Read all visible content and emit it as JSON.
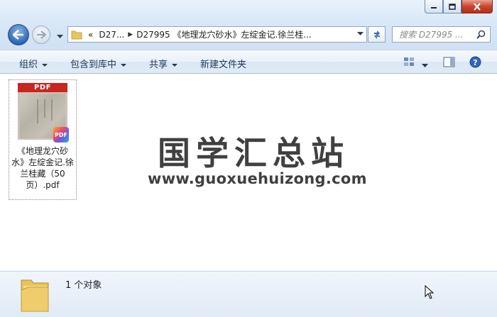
{
  "window": {
    "caption_buttons": [
      "minimize",
      "maximize",
      "close"
    ]
  },
  "address_bar": {
    "overflow_glyph": "«",
    "crumbs": [
      "D27...",
      "D27995 《地理龙穴砂水》左绽金记.徐兰桂..."
    ]
  },
  "search": {
    "placeholder": "搜索 D27995 ..."
  },
  "commands": {
    "organize": "组织",
    "include_in_library": "包含到库中",
    "share": "共享",
    "new_folder": "新建文件夹"
  },
  "files": [
    {
      "name": "《地理龙穴砂水》左绽金记.徐兰桂藏（50页）.pdf",
      "thumb_band": "PDF",
      "badge": "PDF"
    }
  ],
  "watermark": {
    "title": "国学汇总站",
    "url": "www.guoxuehuizong.com"
  },
  "details": {
    "count_text": "1 个对象"
  },
  "colors": {
    "accent": "#2d66b8",
    "command_text": "#1e395b",
    "close_red": "#c8452f"
  }
}
